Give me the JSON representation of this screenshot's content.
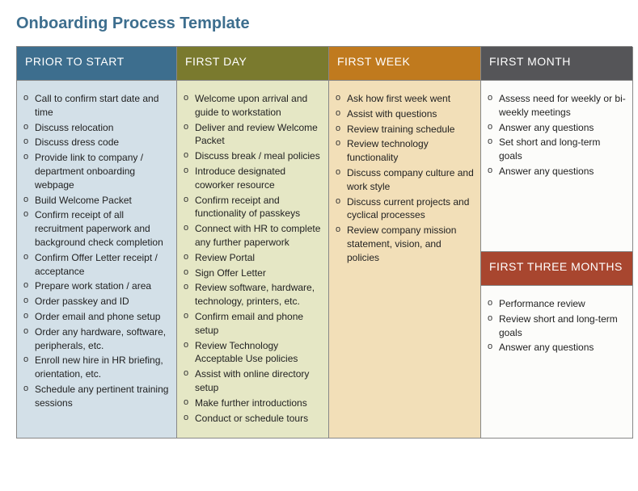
{
  "title": "Onboarding Process Template",
  "columns": {
    "prior": {
      "header": "PRIOR TO START",
      "items": [
        "Call to confirm start date and time",
        "Discuss relocation",
        "Discuss dress code",
        "Provide link to company / department onboarding webpage",
        "Build Welcome Packet",
        "Confirm receipt of all recruitment paperwork and background check completion",
        "Confirm Offer Letter receipt / acceptance",
        "Prepare work station / area",
        "Order passkey and ID",
        "Order email and phone setup",
        "Order any hardware, software, peripherals, etc.",
        "Enroll new hire in HR briefing, orientation, etc.",
        "Schedule any pertinent training sessions"
      ]
    },
    "day": {
      "header": "FIRST DAY",
      "items": [
        "Welcome upon arrival and guide to workstation",
        "Deliver and review Welcome Packet",
        "Discuss break / meal policies",
        "Introduce designated coworker resource",
        "Confirm receipt and functionality of passkeys",
        "Connect with HR to complete any further paperwork",
        "Review Portal",
        "Sign Offer Letter",
        "Review software, hardware, technology, printers, etc.",
        "Confirm email and phone setup",
        "Review Technology Acceptable Use policies",
        "Assist with online directory setup",
        "Make further introductions",
        "Conduct or schedule tours"
      ]
    },
    "week": {
      "header": "FIRST WEEK",
      "items": [
        "Ask how first week went",
        "Assist with questions",
        "Review training schedule",
        "Review technology functionality",
        "Discuss company culture and work style",
        "Discuss current projects and cyclical processes",
        "Review company mission statement, vision, and policies"
      ]
    },
    "month": {
      "header": "FIRST MONTH",
      "items": [
        "Assess need for weekly or bi-weekly meetings",
        "Answer any questions",
        "Set short and long-term goals",
        "Answer any questions"
      ]
    },
    "three": {
      "header": "FIRST THREE MONTHS",
      "items": [
        "Performance review",
        "Review short and long-term goals",
        "Answer any questions"
      ]
    }
  }
}
